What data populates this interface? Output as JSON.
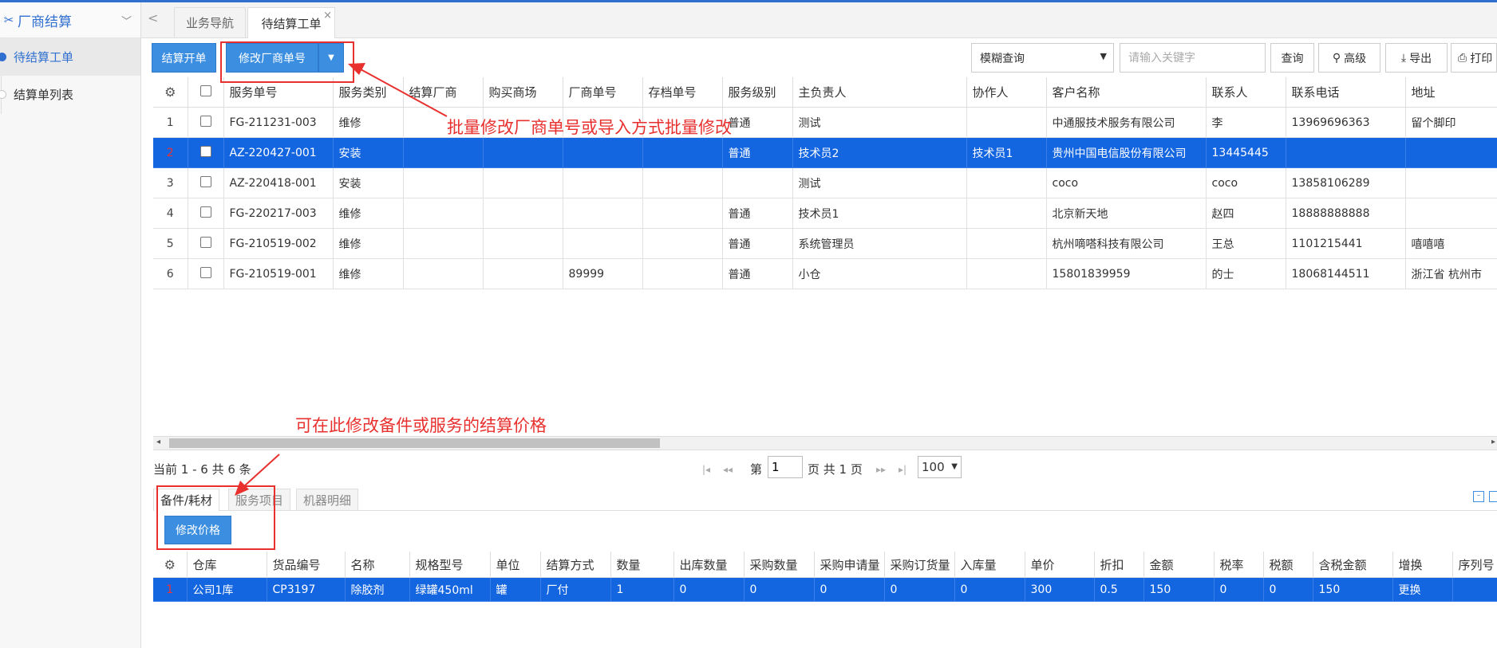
{
  "sidebar": {
    "title": "厂商结算",
    "items": [
      {
        "label": "待结算工单",
        "active": true
      },
      {
        "label": "结算单列表",
        "active": false
      }
    ]
  },
  "tabs": [
    {
      "label": "业务导航",
      "active": false
    },
    {
      "label": "待结算工单",
      "active": true,
      "close": "×"
    }
  ],
  "toolbar": {
    "settle_btn": "结算开单",
    "modify_vendor_btn": "修改厂商单号",
    "search_mode": "模糊查询",
    "keyword_placeholder": "请输入关键字",
    "query_btn": "查询",
    "advanced_btn": "高级",
    "export_btn": "导出",
    "print_btn": "打印"
  },
  "orders_table": {
    "columns": [
      "服务单号",
      "服务类别",
      "结算厂商",
      "购买商场",
      "厂商单号",
      "存档单号",
      "服务级别",
      "主负责人",
      "协作人",
      "客户名称",
      "联系人",
      "联系电话",
      "地址"
    ],
    "rows": [
      {
        "num": "1",
        "cells": [
          "FG-211231-003",
          "维修",
          "",
          "",
          "",
          "",
          "普通",
          "测试",
          "",
          "中通服技术服务有限公司",
          "李",
          "13969696363",
          "留个脚印"
        ],
        "selected": false
      },
      {
        "num": "2",
        "cells": [
          "AZ-220427-001",
          "安装",
          "",
          "",
          "",
          "",
          "普通",
          "技术员2",
          "技术员1",
          "贵州中国电信股份有限公司",
          "13445445",
          "",
          ""
        ],
        "selected": true
      },
      {
        "num": "3",
        "cells": [
          "AZ-220418-001",
          "安装",
          "",
          "",
          "",
          "",
          "",
          "测试",
          "",
          "coco",
          "coco",
          "13858106289",
          ""
        ],
        "selected": false
      },
      {
        "num": "4",
        "cells": [
          "FG-220217-003",
          "维修",
          "",
          "",
          "",
          "",
          "普通",
          "技术员1",
          "",
          "北京新天地",
          "赵四",
          "18888888888",
          ""
        ],
        "selected": false
      },
      {
        "num": "5",
        "cells": [
          "FG-210519-002",
          "维修",
          "",
          "",
          "",
          "",
          "普通",
          "系统管理员",
          "",
          "杭州嘀嗒科技有限公司",
          "王总",
          "1101215441",
          "嘻嘻嘻"
        ],
        "selected": false
      },
      {
        "num": "6",
        "cells": [
          "FG-210519-001",
          "维修",
          "",
          "",
          "89999",
          "",
          "普通",
          "小仓",
          "",
          "15801839959",
          "的士",
          "18068144511",
          "浙江省 杭州市"
        ],
        "selected": false
      }
    ]
  },
  "pager": {
    "info": "当前 1 - 6 共 6 条",
    "page_prefix": "第",
    "page_value": "1",
    "page_suffix": "页 共 1 页",
    "page_size": "100"
  },
  "lower_tabs": [
    {
      "label": "备件/耗材",
      "active": true
    },
    {
      "label": "服务项目",
      "active": false
    },
    {
      "label": "机器明细",
      "active": false
    }
  ],
  "modify_price_btn": "修改价格",
  "parts_table": {
    "columns": [
      "仓库",
      "货品编号",
      "名称",
      "规格型号",
      "单位",
      "结算方式",
      "数量",
      "出库数量",
      "采购数量",
      "采购申请量",
      "采购订货量",
      "入库量",
      "单价",
      "折扣",
      "金额",
      "税率",
      "税额",
      "含税金额",
      "增换",
      "序列号"
    ],
    "rows": [
      {
        "num": "1",
        "cells": [
          "公司1库",
          "CP3197",
          "除胶剂",
          "绿罐450ml",
          "罐",
          "厂付",
          "1",
          "0",
          "0",
          "0",
          "0",
          "0",
          "300",
          "0.5",
          "150",
          "0",
          "0",
          "150",
          "更换",
          ""
        ]
      }
    ]
  },
  "annotations": {
    "batch_modify": "批量修改厂商单号或导入方式批量修改",
    "modify_price": "可在此修改备件或服务的结算价格"
  },
  "colors": {
    "accent": "#3c8fe0",
    "selected_row": "#1365e0",
    "annotation_red": "#e8312f"
  }
}
